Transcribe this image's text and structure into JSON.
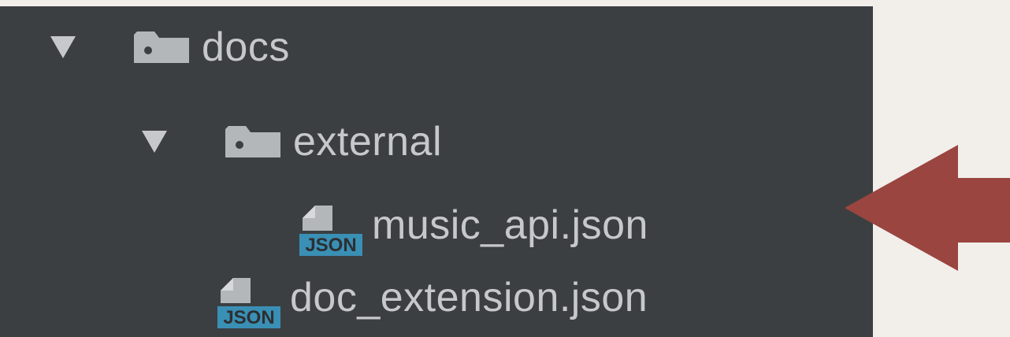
{
  "tree": {
    "root_folder": {
      "name": "docs",
      "expanded": true,
      "icon": "folder-icon"
    },
    "sub_folder": {
      "name": "external",
      "expanded": true,
      "icon": "folder-icon"
    },
    "sub_file": {
      "name": "music_api.json",
      "badge": "JSON",
      "icon": "json-file-icon"
    },
    "root_file": {
      "name": "doc_extension.json",
      "badge": "JSON",
      "icon": "json-file-icon"
    }
  },
  "annotation": {
    "icon": "arrow-left-icon",
    "color": "#9a4540"
  },
  "colors": {
    "panel_bg": "#3c3f41",
    "text": "#c6c8ca",
    "json_badge": "#3a8fb5",
    "page_bg": "#f2efeb"
  }
}
